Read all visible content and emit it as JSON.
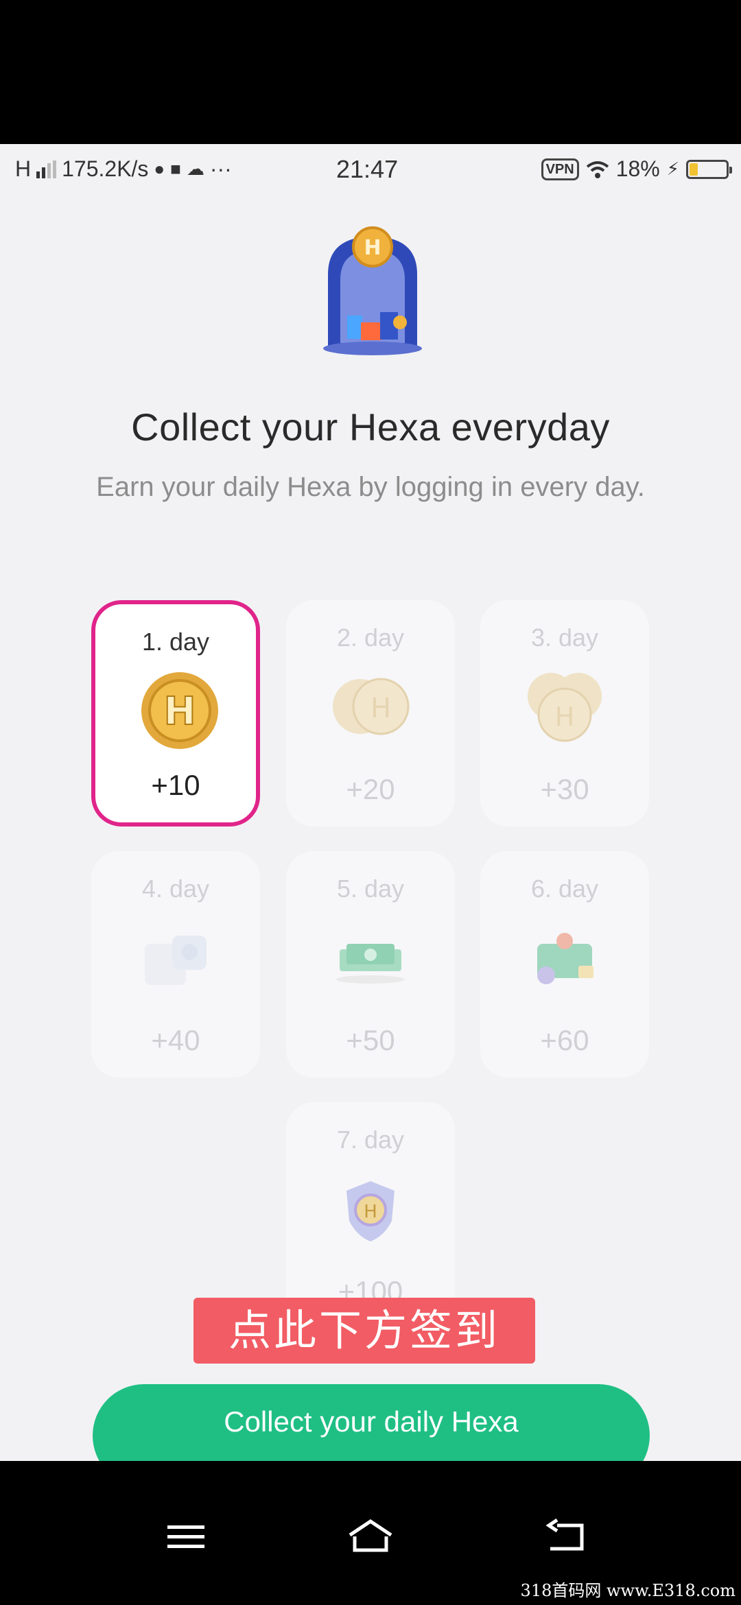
{
  "status_bar": {
    "network": "H",
    "speed": "175.2K/s",
    "more": "···",
    "time": "21:47",
    "vpn": "VPN",
    "battery_percent": "18%",
    "battery_level": 0.18
  },
  "header": {
    "title": "Collect your Hexa everyday",
    "subtitle": "Earn your daily Hexa by logging in every day."
  },
  "days": [
    {
      "label": "1. day",
      "reward": "+10",
      "icon": "coin-icon",
      "active": true
    },
    {
      "label": "2. day",
      "reward": "+20",
      "icon": "two-coins-icon",
      "active": false
    },
    {
      "label": "3. day",
      "reward": "+30",
      "icon": "coin-stack-icon",
      "active": false
    },
    {
      "label": "4. day",
      "reward": "+40",
      "icon": "gift-icon",
      "active": false
    },
    {
      "label": "5. day",
      "reward": "+50",
      "icon": "cash-icon",
      "active": false
    },
    {
      "label": "6. day",
      "reward": "+60",
      "icon": "wallet-icon",
      "active": false
    },
    {
      "label": "7. day",
      "reward": "+100",
      "icon": "shield-badge-icon",
      "active": false
    }
  ],
  "overlay_banner": "点此下方签到",
  "cta": {
    "label": "Collect your daily Hexa"
  },
  "watermark": "318首码网 www.E318.com",
  "colors": {
    "accent_active": "#e0248a",
    "cta": "#1fbf84",
    "banner": "#f25c64",
    "coin": "#e0a83a"
  }
}
